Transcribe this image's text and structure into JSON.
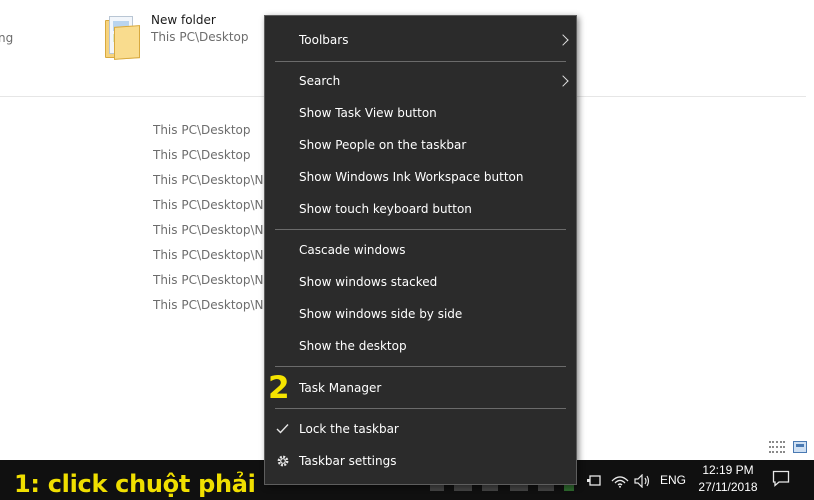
{
  "explorer": {
    "cut_label": "ng",
    "recent_item": {
      "name": "New folder",
      "path": "This PC\\Desktop",
      "icon": "folder-icon"
    },
    "paths": [
      "This PC\\Desktop",
      "This PC\\Desktop",
      "This PC\\Desktop\\New",
      "This PC\\Desktop\\New",
      "This PC\\Desktop\\New",
      "This PC\\Desktop\\New",
      "This PC\\Desktop\\New",
      "This PC\\Desktop\\New"
    ]
  },
  "context_menu": {
    "items": [
      {
        "label": "Toolbars",
        "submenu": true
      },
      {
        "label": "Search",
        "submenu": true
      },
      {
        "label": "Show Task View button"
      },
      {
        "label": "Show People on the taskbar"
      },
      {
        "label": "Show Windows Ink Workspace button"
      },
      {
        "label": "Show touch keyboard button"
      },
      {
        "label": "Cascade windows"
      },
      {
        "label": "Show windows stacked"
      },
      {
        "label": "Show windows side by side"
      },
      {
        "label": "Show the desktop"
      },
      {
        "label": "Task Manager"
      },
      {
        "label": "Lock the taskbar",
        "checked": true
      },
      {
        "label": "Taskbar settings",
        "icon": "gear-icon"
      }
    ]
  },
  "annotations": {
    "step1": "1: click chuột phải",
    "step2": "2",
    "color": "#f5e400"
  },
  "taskbar": {
    "language": "ENG",
    "time": "12:19 PM",
    "date": "27/11/2018",
    "tray_icons": [
      "power-icon",
      "wifi-icon",
      "volume-icon"
    ],
    "notification_icon": "action-center-icon"
  },
  "colors": {
    "menu_bg": "#2b2b2b",
    "taskbar_bg": "#101010",
    "annotation": "#f5e400"
  }
}
